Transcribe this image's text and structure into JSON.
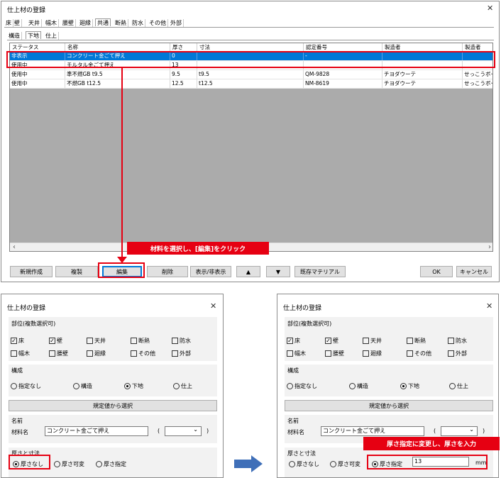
{
  "main_window": {
    "title": "仕上材の登録",
    "close": "✕",
    "top_tabs": [
      "床",
      "壁",
      "天井",
      "幅木",
      "腰壁",
      "廻縁",
      "共通",
      "断熱",
      "防水",
      "その他",
      "外部"
    ],
    "sub_tabs": [
      "構造",
      "下地",
      "仕上"
    ],
    "columns": [
      "ステータス",
      "名称",
      "厚さ",
      "寸法",
      "認定番号",
      "製造者",
      "製造者"
    ],
    "rows": [
      [
        "非表示",
        "コンクリート金ごて押え",
        "0",
        "",
        "-",
        "",
        ""
      ],
      [
        "使用中",
        "モルタル金ごて押え",
        "13",
        "",
        "",
        "",
        ""
      ],
      [
        "使用中",
        "準不燃GB t9.5",
        "9.5",
        "t9.5",
        "QM-9828",
        "チヨダウーテ",
        "せっこうボー"
      ],
      [
        "使用中",
        "不燃GB t12.5",
        "12.5",
        "t12.5",
        "NM-8619",
        "チヨダウーテ",
        "せっこうボー"
      ]
    ],
    "buttons": {
      "new": "新規作成",
      "copy": "複製",
      "edit": "編集",
      "delete": "削除",
      "toggle": "表示/非表示",
      "up": "▲",
      "down": "▼",
      "existing": "既存マテリアル",
      "ok": "OK",
      "cancel": "キャンセル"
    },
    "scroll_left": "‹",
    "scroll_right": "›"
  },
  "callout_edit": "材料を選択し、[編集]をクリック",
  "callout_thickness": "厚さ指定に変更し、厚さを入力",
  "dialogs": {
    "title": "仕上材の登録",
    "close": "✕",
    "part_label": "部位(複数選択可)",
    "parts": [
      "床",
      "壁",
      "天井",
      "断熱",
      "防水",
      "幅木",
      "腰壁",
      "廻縁",
      "その他",
      "外部"
    ],
    "structure_label": "構成",
    "structure_options": [
      "指定なし",
      "構造",
      "下地",
      "仕上"
    ],
    "preset_button": "規定値から選択",
    "name_label": "名前",
    "material_label": "材料名",
    "material_value": "コンクリート金ごて押え",
    "paren_open": "(",
    "paren_close": ")",
    "dropdown_arrow": "⌄",
    "thickness_label": "厚さと寸法",
    "thickness_options": [
      "厚さなし",
      "厚さ可変",
      "厚さ指定"
    ],
    "thickness_value": "13",
    "unit": "mm"
  }
}
